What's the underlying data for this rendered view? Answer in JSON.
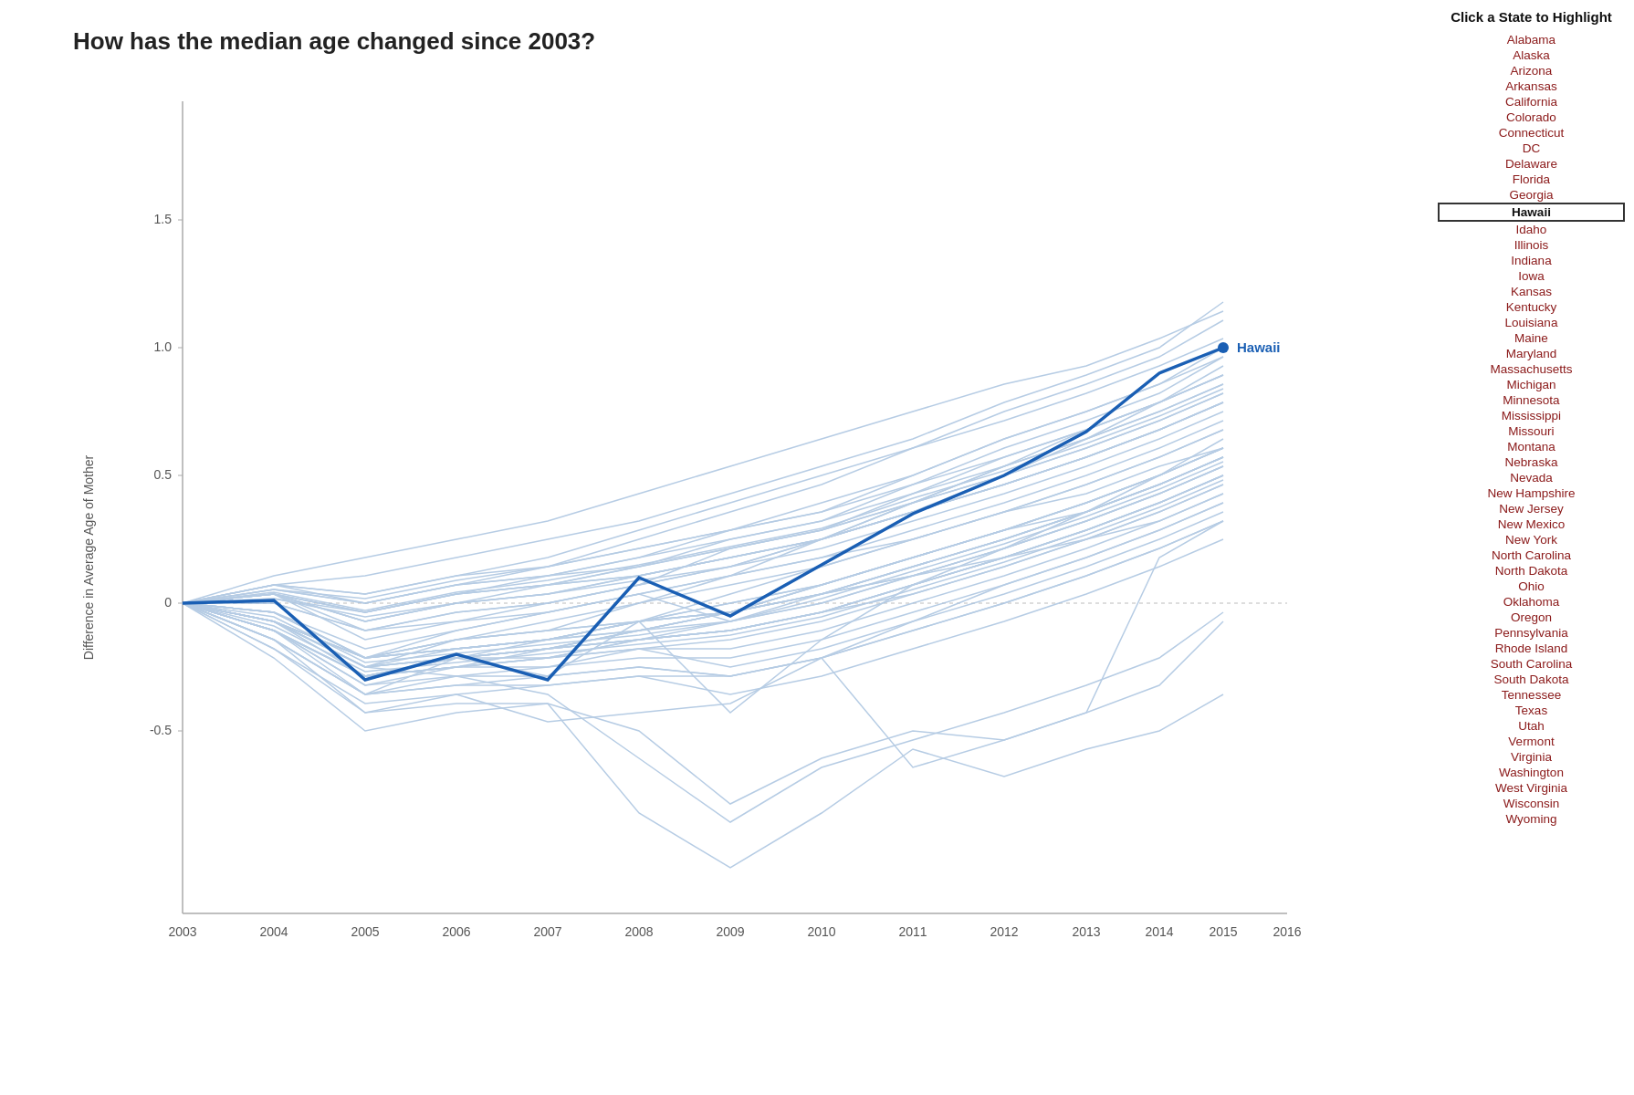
{
  "title": "How has the median age changed since 2003?",
  "sidebar": {
    "instruction": "Click a State to Highlight",
    "states": [
      "Alabama",
      "Alaska",
      "Arizona",
      "Arkansas",
      "California",
      "Colorado",
      "Connecticut",
      "DC",
      "Delaware",
      "Florida",
      "Georgia",
      "Hawaii",
      "Idaho",
      "Illinois",
      "Indiana",
      "Iowa",
      "Kansas",
      "Kentucky",
      "Louisiana",
      "Maine",
      "Maryland",
      "Massachusetts",
      "Michigan",
      "Minnesota",
      "Mississippi",
      "Missouri",
      "Montana",
      "Nebraska",
      "Nevada",
      "New Hampshire",
      "New Jersey",
      "New Mexico",
      "New York",
      "North Carolina",
      "North Dakota",
      "Ohio",
      "Oklahoma",
      "Oregon",
      "Pennsylvania",
      "Rhode Island",
      "South Carolina",
      "South Dakota",
      "Tennessee",
      "Texas",
      "Utah",
      "Vermont",
      "Virginia",
      "Washington",
      "West Virginia",
      "Wisconsin",
      "Wyoming"
    ],
    "highlighted": "Hawaii"
  },
  "chart": {
    "y_axis_label": "Difference in Average Age of Mother",
    "x_labels": [
      "2003",
      "2004",
      "2005",
      "2006",
      "2007",
      "2008",
      "2009",
      "2010",
      "2011",
      "2012",
      "2013",
      "2014",
      "2015",
      "2016"
    ],
    "y_ticks": [
      "-0.5",
      "0",
      "0.5",
      "1.0",
      "1.5"
    ],
    "highlighted_state": "Hawaii",
    "highlighted_label_x": 1282,
    "highlighted_label_y": 370
  },
  "colors": {
    "highlight_line": "#1a5fb4",
    "background_lines": "#aac4e0",
    "axis": "#999",
    "zero_line": "#ccc",
    "title": "#111"
  }
}
